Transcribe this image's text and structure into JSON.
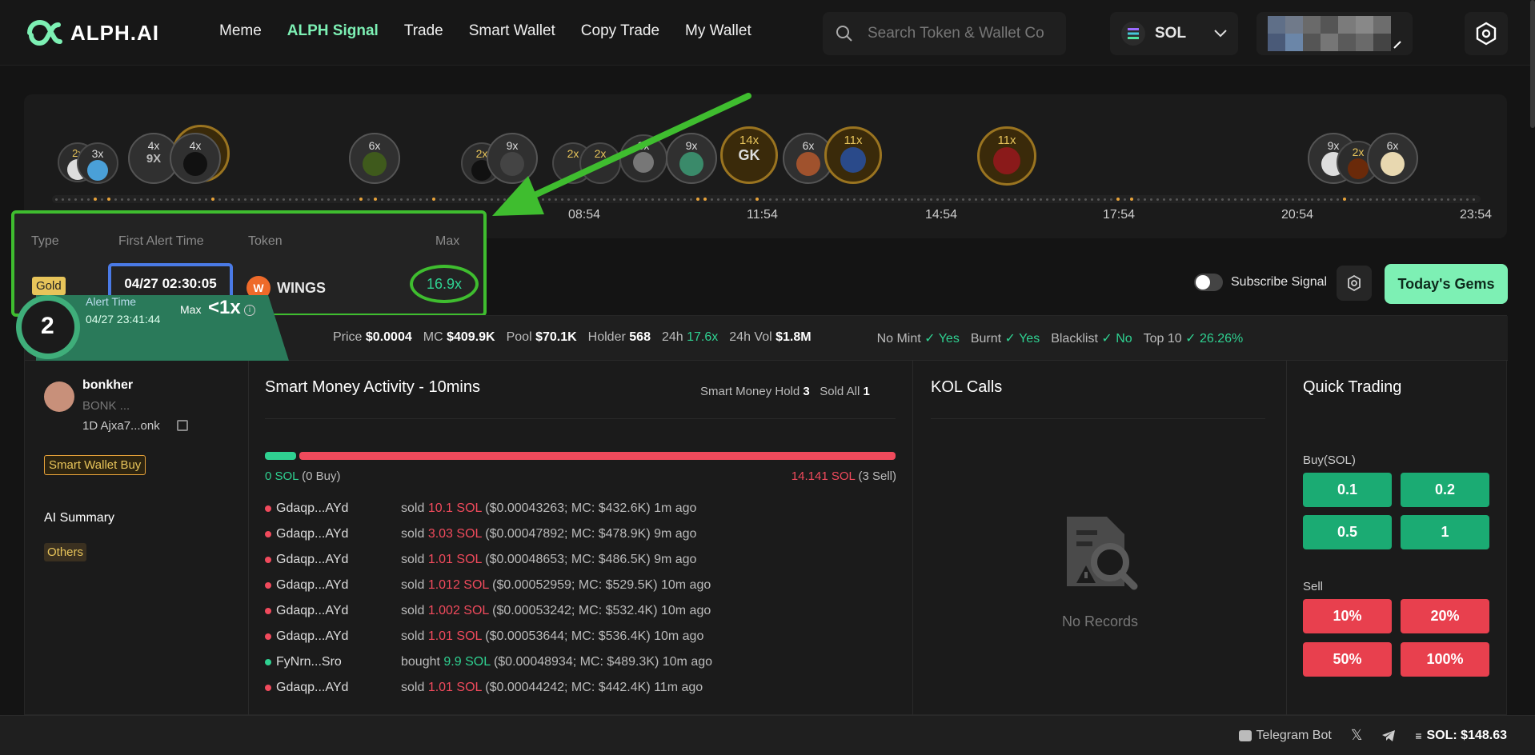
{
  "brand": {
    "name": "ALPH.AI"
  },
  "nav": [
    "Meme",
    "ALPH Signal",
    "Trade",
    "Smart Wallet",
    "Copy Trade",
    "My Wallet"
  ],
  "search": {
    "placeholder": "Search Token & Wallet Contract"
  },
  "chain": {
    "label": "SOL"
  },
  "timeline": {
    "labels": [
      "08:54",
      "11:54",
      "14:54",
      "17:54",
      "20:54",
      "23:54"
    ],
    "bubbles": [
      "2x",
      "3x",
      "4x",
      "4x",
      "6x",
      "2x",
      "9x",
      "2x",
      "2x",
      "3x",
      "9x",
      "14x",
      "6x",
      "11x",
      "11x",
      "9x",
      "2x",
      "6x"
    ],
    "bubble_texts": {
      "nine_x": "9X",
      "gk": "GK"
    }
  },
  "popup": {
    "headers": {
      "type": "Type",
      "first_alert_time": "First Alert Time",
      "token": "Token",
      "max": "Max"
    },
    "type": "Gold",
    "first_alert_time": "04/27 02:30:05",
    "token": "WINGS",
    "max": "16.9x"
  },
  "controls": {
    "subscribe": "Subscribe Signal",
    "gems": "Today's Gems"
  },
  "card": {
    "rank": "2",
    "alert_time_label": "Alert Time",
    "alert_time": "04/27 23:41:44",
    "max_label": "Max",
    "max_value": "<1x",
    "stats": {
      "price_label": "Price",
      "price": "$0.0004",
      "mc_label": "MC",
      "mc": "$409.9K",
      "pool_label": "Pool",
      "pool": "$70.1K",
      "holder_label": "Holder",
      "holder": "568",
      "h24_label": "24h",
      "h24": "17.6x",
      "vol_label": "24h Vol",
      "vol": "$1.8M",
      "nomint_label": "No Mint",
      "nomint": "Yes",
      "burnt_label": "Burnt",
      "burnt": "Yes",
      "blacklist_label": "Blacklist",
      "blacklist": "No",
      "top10_label": "Top 10",
      "top10": "26.26%"
    }
  },
  "token_info": {
    "name": "bonkher",
    "symbol": "BONK ...",
    "meta": "1D Ajxa7...onk",
    "tag": "Smart Wallet Buy",
    "ai_summary": "AI Summary",
    "others": "Others"
  },
  "smart_money": {
    "title": "Smart Money Activity - 10mins",
    "hold_label": "Smart Money Hold",
    "hold": "3",
    "sold_all_label": "Sold All",
    "sold_all": "1",
    "buy_sol": "0 SOL",
    "buy_count": "(0 Buy)",
    "sell_sol": "14.141 SOL",
    "sell_count": "(3 Sell)",
    "buy_fraction": 0.05,
    "rows": [
      {
        "wallet": "Gdaqp...AYd",
        "action": "sold",
        "amount": "10.1 SOL",
        "detail": "($0.00043263; MC: $432.6K) 1m ago",
        "side": "sell"
      },
      {
        "wallet": "Gdaqp...AYd",
        "action": "sold",
        "amount": "3.03 SOL",
        "detail": "($0.00047892; MC: $478.9K) 9m ago",
        "side": "sell"
      },
      {
        "wallet": "Gdaqp...AYd",
        "action": "sold",
        "amount": "1.01 SOL",
        "detail": "($0.00048653; MC: $486.5K) 9m ago",
        "side": "sell"
      },
      {
        "wallet": "Gdaqp...AYd",
        "action": "sold",
        "amount": "1.012 SOL",
        "detail": "($0.00052959; MC: $529.5K) 10m ago",
        "side": "sell"
      },
      {
        "wallet": "Gdaqp...AYd",
        "action": "sold",
        "amount": "1.002 SOL",
        "detail": "($0.00053242; MC: $532.4K) 10m ago",
        "side": "sell"
      },
      {
        "wallet": "Gdaqp...AYd",
        "action": "sold",
        "amount": "1.01 SOL",
        "detail": "($0.00053644; MC: $536.4K) 10m ago",
        "side": "sell"
      },
      {
        "wallet": "FyNrn...Sro",
        "action": "bought",
        "amount": "9.9 SOL",
        "detail": "($0.00048934; MC: $489.3K) 10m ago",
        "side": "buy"
      },
      {
        "wallet": "Gdaqp...AYd",
        "action": "sold",
        "amount": "1.01 SOL",
        "detail": "($0.00044242; MC: $442.4K) 11m ago",
        "side": "sell"
      }
    ]
  },
  "kol": {
    "title": "KOL Calls",
    "empty": "No Records"
  },
  "quick": {
    "title": "Quick Trading",
    "buy_label": "Buy(SOL)",
    "buy": [
      "0.1",
      "0.2",
      "0.5",
      "1"
    ],
    "sell_label": "Sell",
    "sell": [
      "10%",
      "20%",
      "50%",
      "100%"
    ]
  },
  "footer": {
    "bot": "Telegram Bot",
    "sol_price": "SOL: $148.63"
  },
  "colors": {
    "accent": "#7df0b4",
    "green": "#2fd191",
    "red": "#f04a5c",
    "gold": "#e7c45a",
    "highlight_green": "#3fbd2f",
    "highlight_blue": "#4a7ae6"
  }
}
